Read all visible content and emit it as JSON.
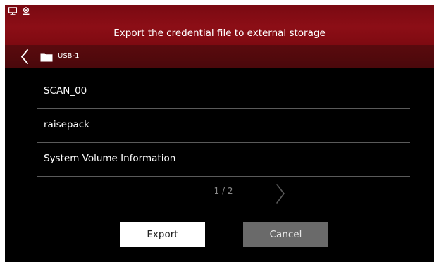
{
  "header": {
    "title": "Export the credential file to external storage",
    "status_icons": [
      "monitor-icon",
      "user-icon"
    ],
    "accent_color": "#8c0e16"
  },
  "path_bar": {
    "back_icon": "chevron-left-icon",
    "folder_icon": "folder-icon",
    "current_folder": "USB-1"
  },
  "files": [
    {
      "name": "SCAN_00"
    },
    {
      "name": "raisepack"
    },
    {
      "name": "System Volume Information"
    }
  ],
  "pagination": {
    "text": "1 / 2",
    "current": 1,
    "total": 2,
    "next_icon": "chevron-right-icon"
  },
  "actions": {
    "export_label": "Export",
    "cancel_label": "Cancel"
  }
}
